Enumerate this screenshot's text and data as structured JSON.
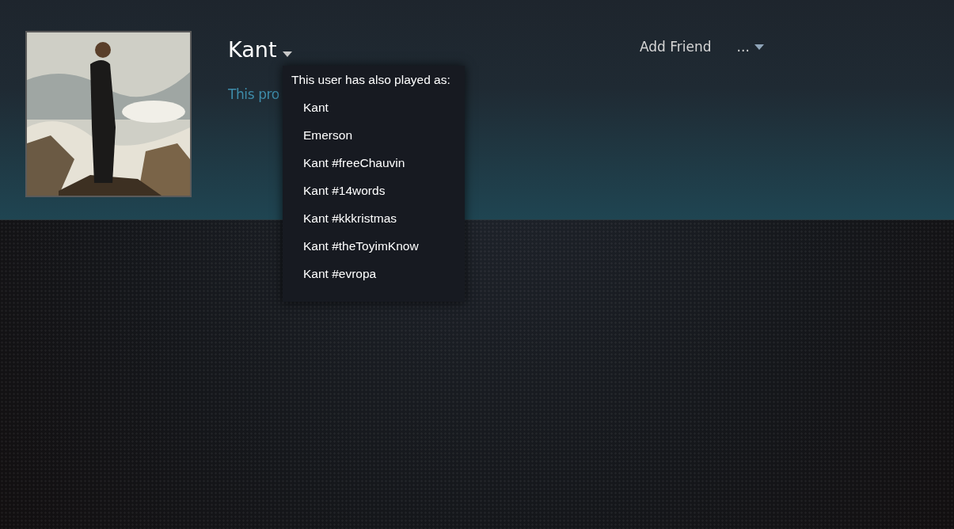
{
  "profile": {
    "name": "Kant",
    "summary": "This pro"
  },
  "actions": {
    "add_friend": "Add Friend",
    "more": "..."
  },
  "alias_popup": {
    "title": "This user has also played as:",
    "aliases": [
      "Kant",
      "Emerson",
      "Kant #freeChauvin",
      "Kant #14words",
      "Kant #kkkristmas",
      "Kant #theToyimKnow",
      "Kant #evropa"
    ]
  }
}
